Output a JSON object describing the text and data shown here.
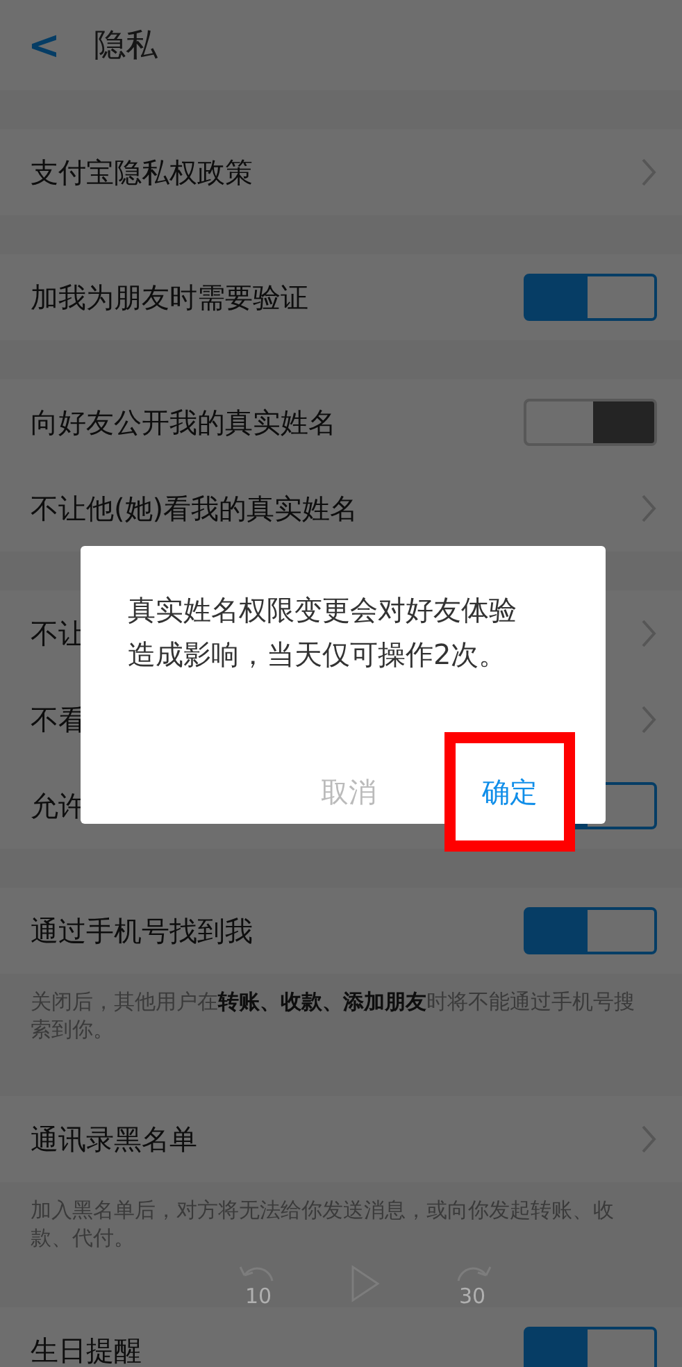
{
  "header": {
    "back": "<",
    "title": "隐私"
  },
  "groups": [
    {
      "items": [
        {
          "kind": "link",
          "label": "支付宝隐私权政策"
        }
      ]
    },
    {
      "items": [
        {
          "kind": "toggle",
          "label": "加我为朋友时需要验证",
          "on": true
        }
      ]
    },
    {
      "items": [
        {
          "kind": "toggle",
          "label": "向好友公开我的真实姓名",
          "on": false
        },
        {
          "kind": "link",
          "label": "不让他(她)看我的真实姓名"
        }
      ]
    },
    {
      "items": [
        {
          "kind": "link",
          "label": "不让"
        },
        {
          "kind": "link",
          "label": "不看"
        },
        {
          "kind": "toggle",
          "label": "允许",
          "on": true
        }
      ]
    },
    {
      "items": [
        {
          "kind": "toggle",
          "label": "通过手机号找到我",
          "on": true
        }
      ],
      "note": "关闭后，其他用户在**转账、收款、添加朋友**时将不能通过手机号搜索到你。"
    },
    {
      "items": [
        {
          "kind": "link",
          "label": "通讯录黑名单"
        }
      ],
      "note": "加入黑名单后，对方将无法给你发送消息，或向你发起转账、收款、代付。"
    },
    {
      "items": [
        {
          "kind": "toggle",
          "label": "生日提醒",
          "on": true
        }
      ]
    }
  ],
  "dialog": {
    "message": "真实姓名权限变更会对好友体验造成影响，当天仅可操作2次。",
    "buttons": [
      {
        "label": "取消",
        "kind": "cancel",
        "highlighted": false
      },
      {
        "label": "确定",
        "kind": "confirm",
        "highlighted": true
      }
    ]
  },
  "player_controls": {
    "rewind": "10",
    "forward": "30"
  }
}
